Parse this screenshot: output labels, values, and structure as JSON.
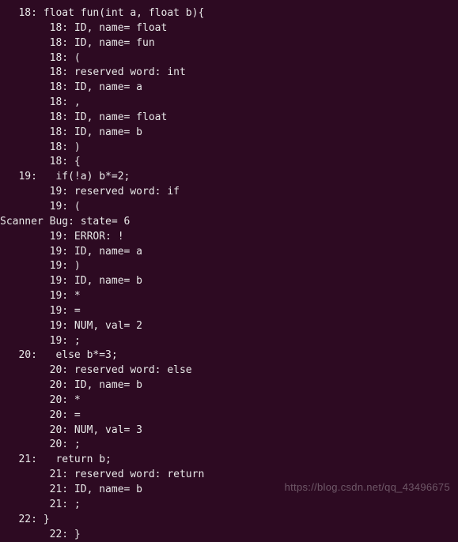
{
  "lines": [
    "   18: float fun(int a, float b){",
    "        18: ID, name= float",
    "        18: ID, name= fun",
    "        18: (",
    "        18: reserved word: int",
    "        18: ID, name= a",
    "        18: ,",
    "        18: ID, name= float",
    "        18: ID, name= b",
    "        18: )",
    "        18: {",
    "   19:   if(!a) b*=2;",
    "        19: reserved word: if",
    "        19: (",
    "Scanner Bug: state= 6",
    "        19: ERROR: !",
    "        19: ID, name= a",
    "        19: )",
    "        19: ID, name= b",
    "        19: *",
    "        19: =",
    "        19: NUM, val= 2",
    "        19: ;",
    "   20:   else b*=3;",
    "        20: reserved word: else",
    "        20: ID, name= b",
    "        20: *",
    "        20: =",
    "        20: NUM, val= 3",
    "        20: ;",
    "   21:   return b;",
    "        21: reserved word: return",
    "        21: ID, name= b",
    "        21: ;",
    "   22: }",
    "        22: }"
  ],
  "watermark": "https://blog.csdn.net/qq_43496675"
}
